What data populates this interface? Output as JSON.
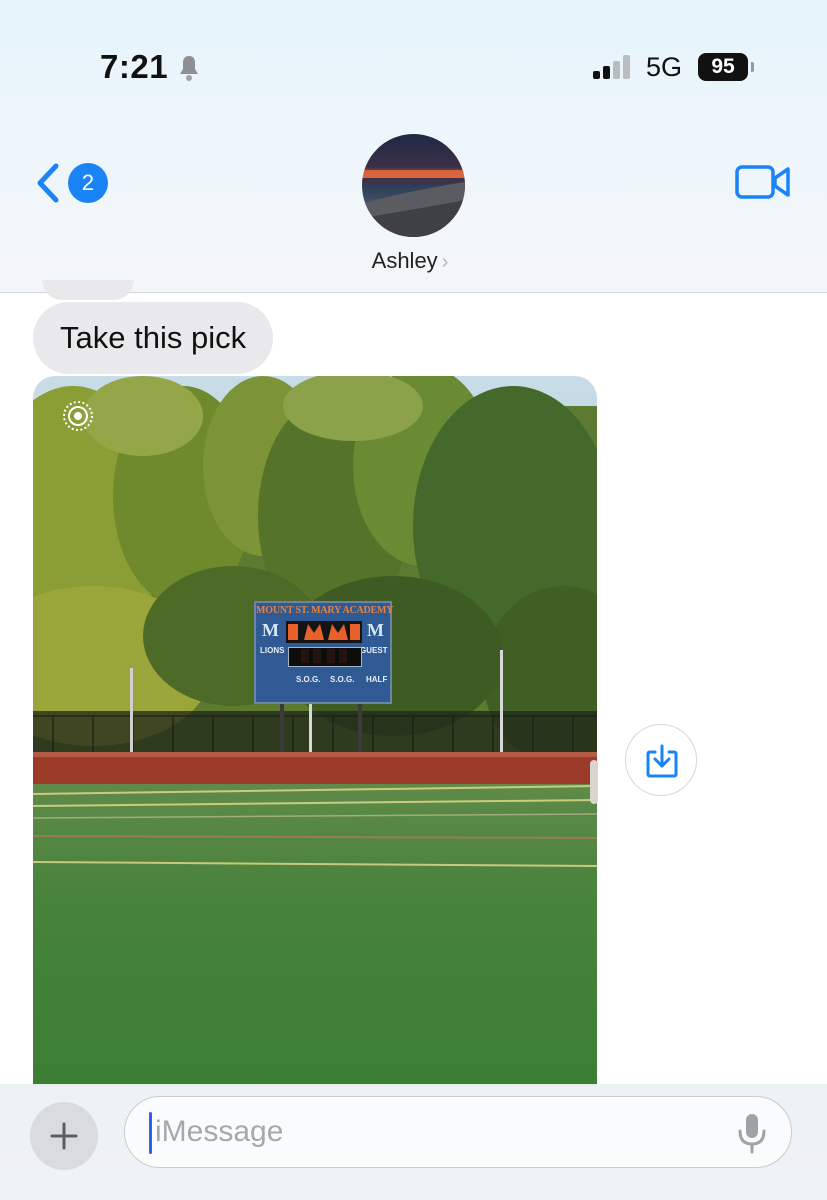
{
  "status_bar": {
    "time": "7:21",
    "network": "5G",
    "battery": "95",
    "signal_bars_active": 2,
    "signal_bars_total": 4
  },
  "nav": {
    "back_badge": "2",
    "contact_name": "Ashley",
    "contact_chevron": "›"
  },
  "icons": {
    "back": "chevron-left-icon",
    "video": "video-camera-icon",
    "live_photo": "live-photo-icon",
    "download": "download-icon",
    "plus": "plus-icon",
    "mic": "microphone-icon"
  },
  "thread": {
    "bubble_text": "Take this pick",
    "photo": {
      "scoreboard_title": "MOUNT ST. MARY ACADEMY",
      "scoreboard_logo": "M",
      "home_label": "LIONS",
      "guest_label": "GUEST",
      "sog_label_1": "S.O.G.",
      "sog_label_2": "S.O.G.",
      "half_label": "HALF"
    }
  },
  "composer": {
    "placeholder": "iMessage"
  },
  "colors": {
    "accent": "#1a84f7",
    "incoming_bubble": "#e9e9eb"
  }
}
